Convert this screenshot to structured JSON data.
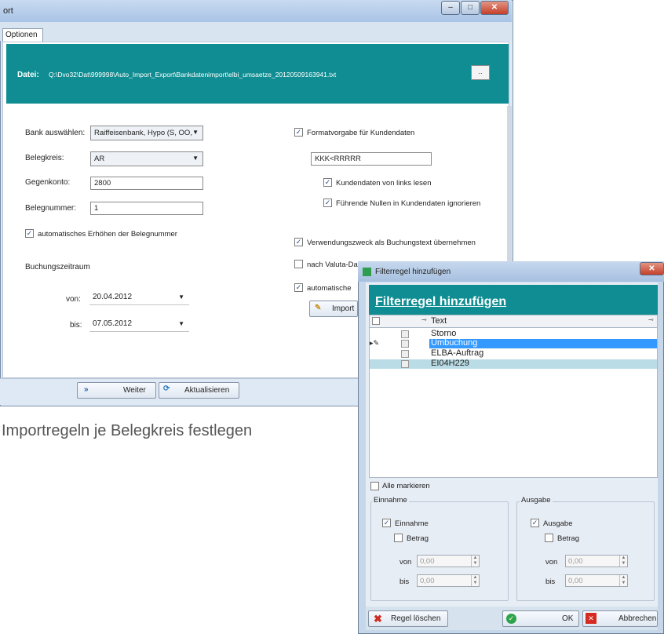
{
  "main_window": {
    "title_fragment": "ort",
    "tab_label": "Optionen",
    "file_label": "Datei:",
    "file_path": "Q:\\Dvo32\\Dat\\999998\\Auto_Import_Export\\Bankdatenimport\\elbi_umsaetze_20120509163941.txt",
    "browse_label": "..",
    "bank_label": "Bank auswählen:",
    "bank_value": "Raiffeisenbank, Hypo (S, OO,",
    "belegkreis_label": "Belegkreis:",
    "belegkreis_value": "AR",
    "gegenkonto_label": "Gegenkonto:",
    "gegenkonto_value": "2800",
    "belegnummer_label": "Belegnummer:",
    "belegnummer_value": "1",
    "auto_increment_label": "automatisches Erhöhen der Belegnummer",
    "buchungszeitraum_label": "Buchungszeitraum",
    "von_label": "von:",
    "von_value": "20.04.2012",
    "bis_label": "bis:",
    "bis_value": "07.05.2012",
    "format_label": "Formatvorgabe für Kundendaten",
    "format_value": "KKK<RRRRR",
    "links_lesen_label": "Kundendaten von links lesen",
    "nullen_label": "Führende Nullen in Kundendaten ignorieren",
    "verwendungszweck_label": "Verwendungszweck als Buchungstext übernehmen",
    "valuta_label": "nach Valuta-Datum buchen",
    "automatische_label": "automatische",
    "import_label": "Import",
    "weiter_label": "Weiter",
    "aktualisieren_label": "Aktualisieren"
  },
  "caption": "Importregeln je Belegkreis festlegen",
  "dialog": {
    "title": "Filterregel hinzufügen",
    "heading": "Filterregel hinzufügen",
    "column_text": "Text",
    "rows": [
      {
        "text": "Storno",
        "selected": false
      },
      {
        "text": "Umbuchung",
        "selected": true
      },
      {
        "text": "ELBA-Auftrag",
        "selected": false
      },
      {
        "text": "EI04H229",
        "selected": false
      }
    ],
    "alle_markieren": "Alle markieren",
    "einnahme_group": "Einnahme",
    "einnahme_check": "Einnahme",
    "ausgabe_group": "Ausgabe",
    "ausgabe_check": "Ausgabe",
    "betrag_label": "Betrag",
    "von_label": "von",
    "bis_label": "bis",
    "zero_value": "0,00",
    "regel_loeschen": "Regel löschen",
    "ok": "OK",
    "abbrechen": "Abbrechen"
  }
}
